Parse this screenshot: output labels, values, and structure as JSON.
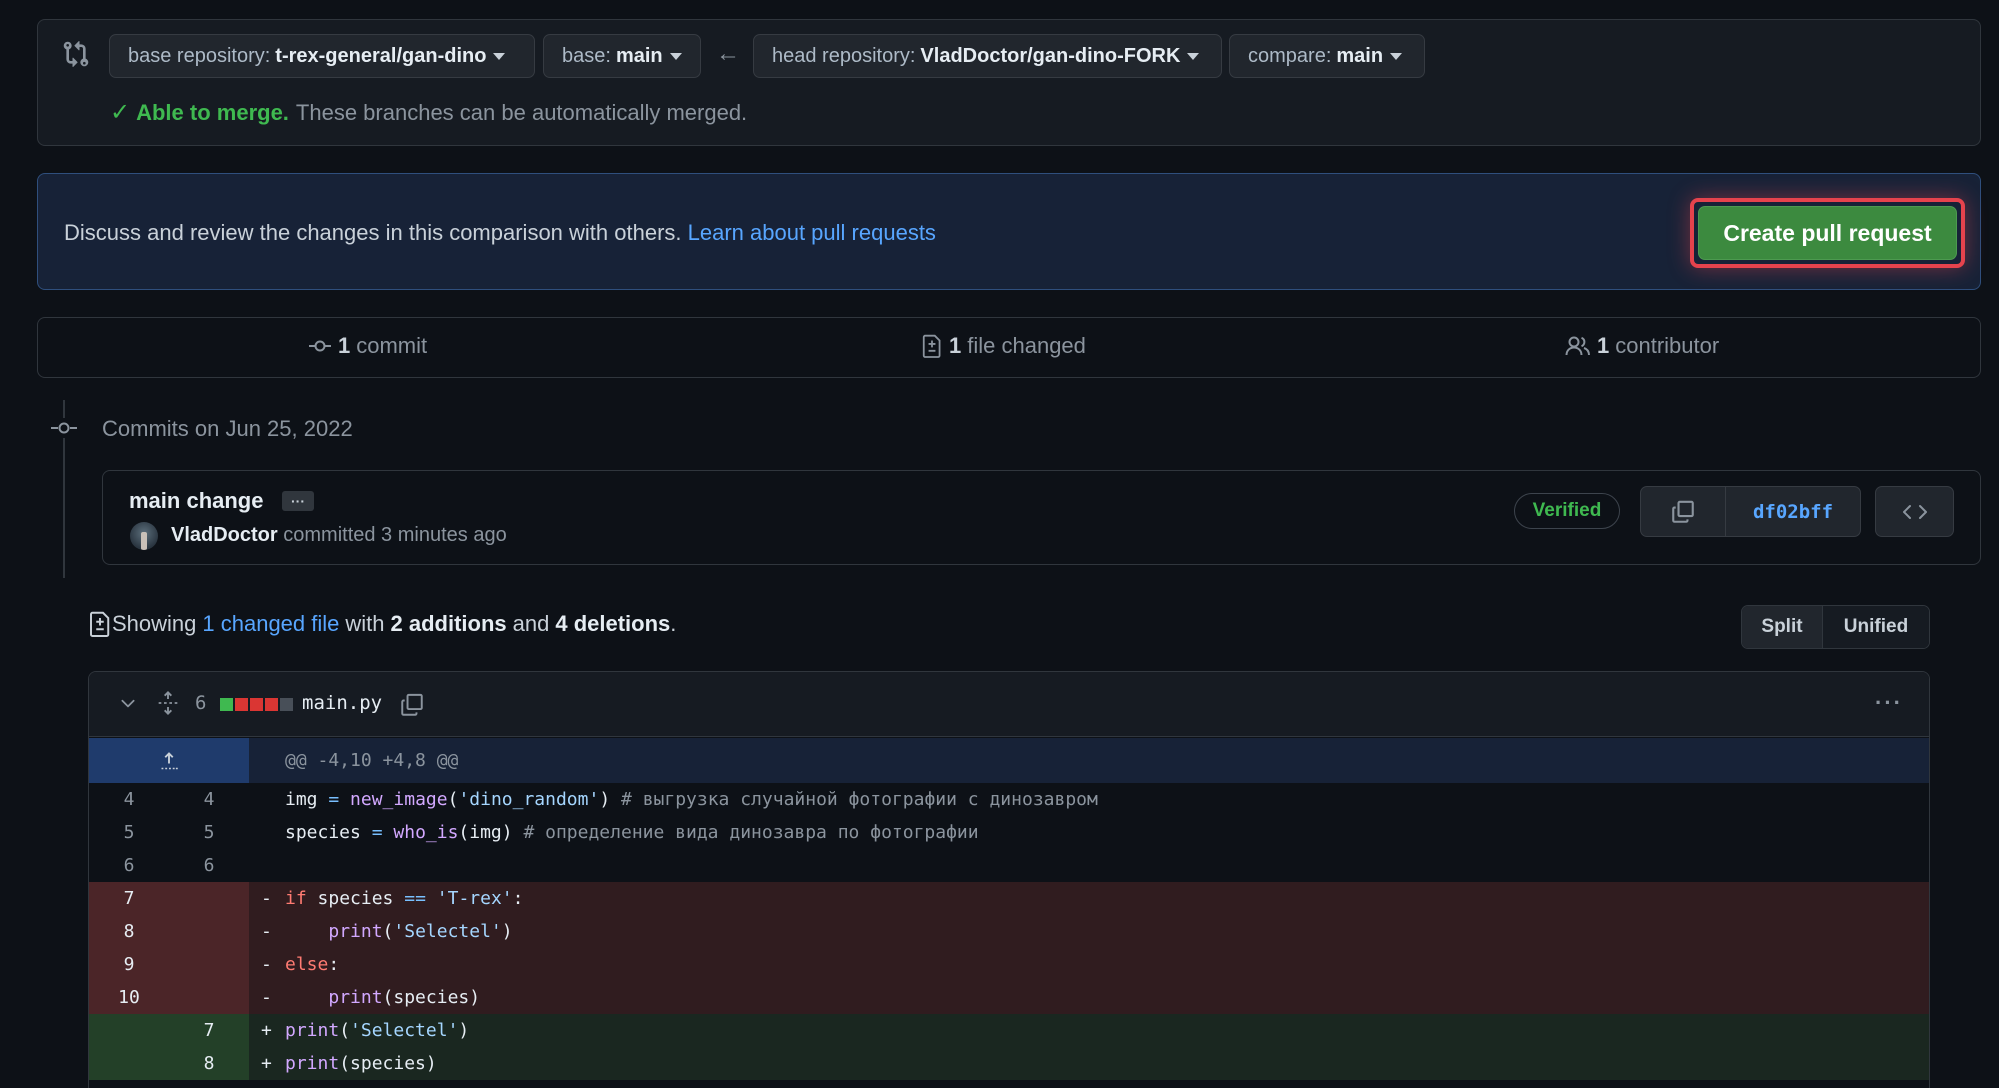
{
  "range": {
    "base_repo_label": "base repository:",
    "base_repo_value": "t-rex-general/gan-dino",
    "base_label": "base:",
    "base_value": "main",
    "head_repo_label": "head repository:",
    "head_repo_value": "VladDoctor/gan-dino-FORK",
    "compare_label": "compare:",
    "compare_value": "main",
    "merge_ok": "Able to merge.",
    "merge_text": "These branches can be automatically merged."
  },
  "banner": {
    "text": "Discuss and review the changes in this comparison with others.",
    "link": "Learn about pull requests",
    "button": "Create pull request",
    "highlight_color": "#e5434d",
    "button_color": "#3c8a3f"
  },
  "stats": {
    "commits_count": "1",
    "commits_label": "commit",
    "files_count": "1",
    "files_label": "file changed",
    "contributors_count": "1",
    "contributors_label": "contributor"
  },
  "commits": {
    "date_heading": "Commits on Jun 25, 2022",
    "items": [
      {
        "title": "main change",
        "ellipsis": "···",
        "author": "VladDoctor",
        "action": "committed 3 minutes ago",
        "badge": "Verified",
        "sha": "df02bff"
      }
    ]
  },
  "summary": {
    "prefix": "Showing",
    "changed_link": "1 changed file",
    "with": "with",
    "additions": "2 additions",
    "and": "and",
    "deletions": "4 deletions",
    "suffix": ".",
    "view_split": "Split",
    "view_unified": "Unified"
  },
  "diff": {
    "file_name": "main.py",
    "change_count": "6",
    "diffstat": [
      "add",
      "del",
      "del",
      "del",
      "neutral"
    ],
    "more": "···",
    "hunk_header": "@@ -4,10 +4,8 @@",
    "lines": [
      {
        "type": "ctx",
        "old": "4",
        "new": "4",
        "sign": "",
        "code": "img = new_image('dino_random') # выгрузка случайной фотографии с динозавром"
      },
      {
        "type": "ctx",
        "old": "5",
        "new": "5",
        "sign": "",
        "code": "species = who_is(img) # определение вида динозавра по фотографии"
      },
      {
        "type": "ctx",
        "old": "6",
        "new": "6",
        "sign": "",
        "code": ""
      },
      {
        "type": "del",
        "old": "7",
        "new": "",
        "sign": "-",
        "code": "if species == 'T-rex':"
      },
      {
        "type": "del",
        "old": "8",
        "new": "",
        "sign": "-",
        "code": "    print('Selectel')"
      },
      {
        "type": "del",
        "old": "9",
        "new": "",
        "sign": "-",
        "code": "else:"
      },
      {
        "type": "del",
        "old": "10",
        "new": "",
        "sign": "-",
        "code": "    print(species)"
      },
      {
        "type": "add",
        "old": "",
        "new": "7",
        "sign": "+",
        "code": "print('Selectel')"
      },
      {
        "type": "add",
        "old": "",
        "new": "8",
        "sign": "+",
        "code": "print(species)"
      }
    ]
  }
}
